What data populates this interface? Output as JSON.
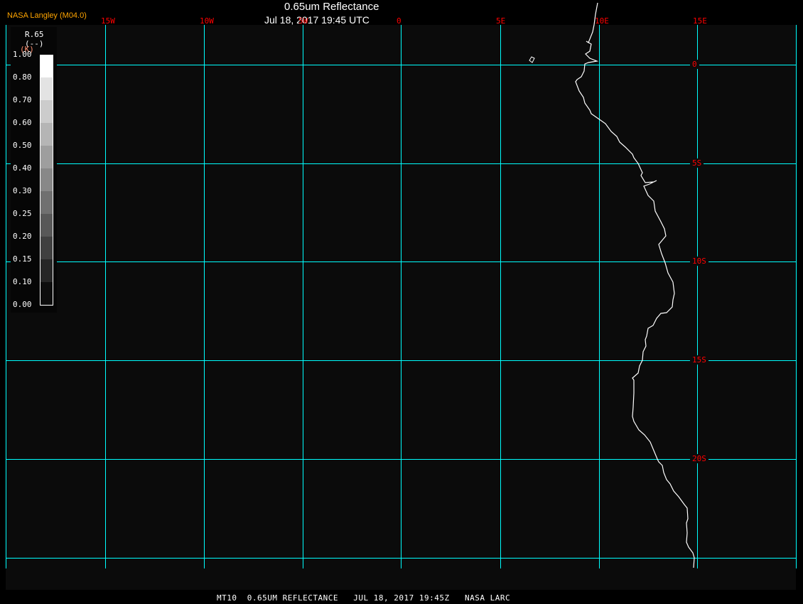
{
  "header": {
    "title": "0.65um Reflectance",
    "datetime": "Jul 18, 2017 19:45 UTC",
    "credit": "NASA Langley (M04.0)"
  },
  "grid": {
    "color": "#00ffff",
    "label_color": "#ff0000",
    "longitudes": [
      "15W",
      "10W",
      "5W",
      "0",
      "5E",
      "10E",
      "15E"
    ],
    "latitudes": [
      "0",
      "5S",
      "10S",
      "15S",
      "20S"
    ]
  },
  "colorbar": {
    "variable": "R.65",
    "units": "(--)",
    "scale_mark": "(K)",
    "labels": [
      "1.00",
      "0.80",
      "0.70",
      "0.60",
      "0.50",
      "0.40",
      "0.30",
      "0.25",
      "0.20",
      "0.15",
      "0.10",
      "0.00"
    ],
    "colors": [
      "#ffffff",
      "#e3e3e3",
      "#cccccc",
      "#b5b5b5",
      "#9e9e9e",
      "#888888",
      "#707070",
      "#585858",
      "#404040",
      "#262626",
      "#0d0d0d"
    ]
  },
  "coastline_color": "#ffffff",
  "footer": {
    "text": "MT10  0.65UM REFLECTANCE   JUL 18, 2017 19:45Z   NASA LARC"
  }
}
